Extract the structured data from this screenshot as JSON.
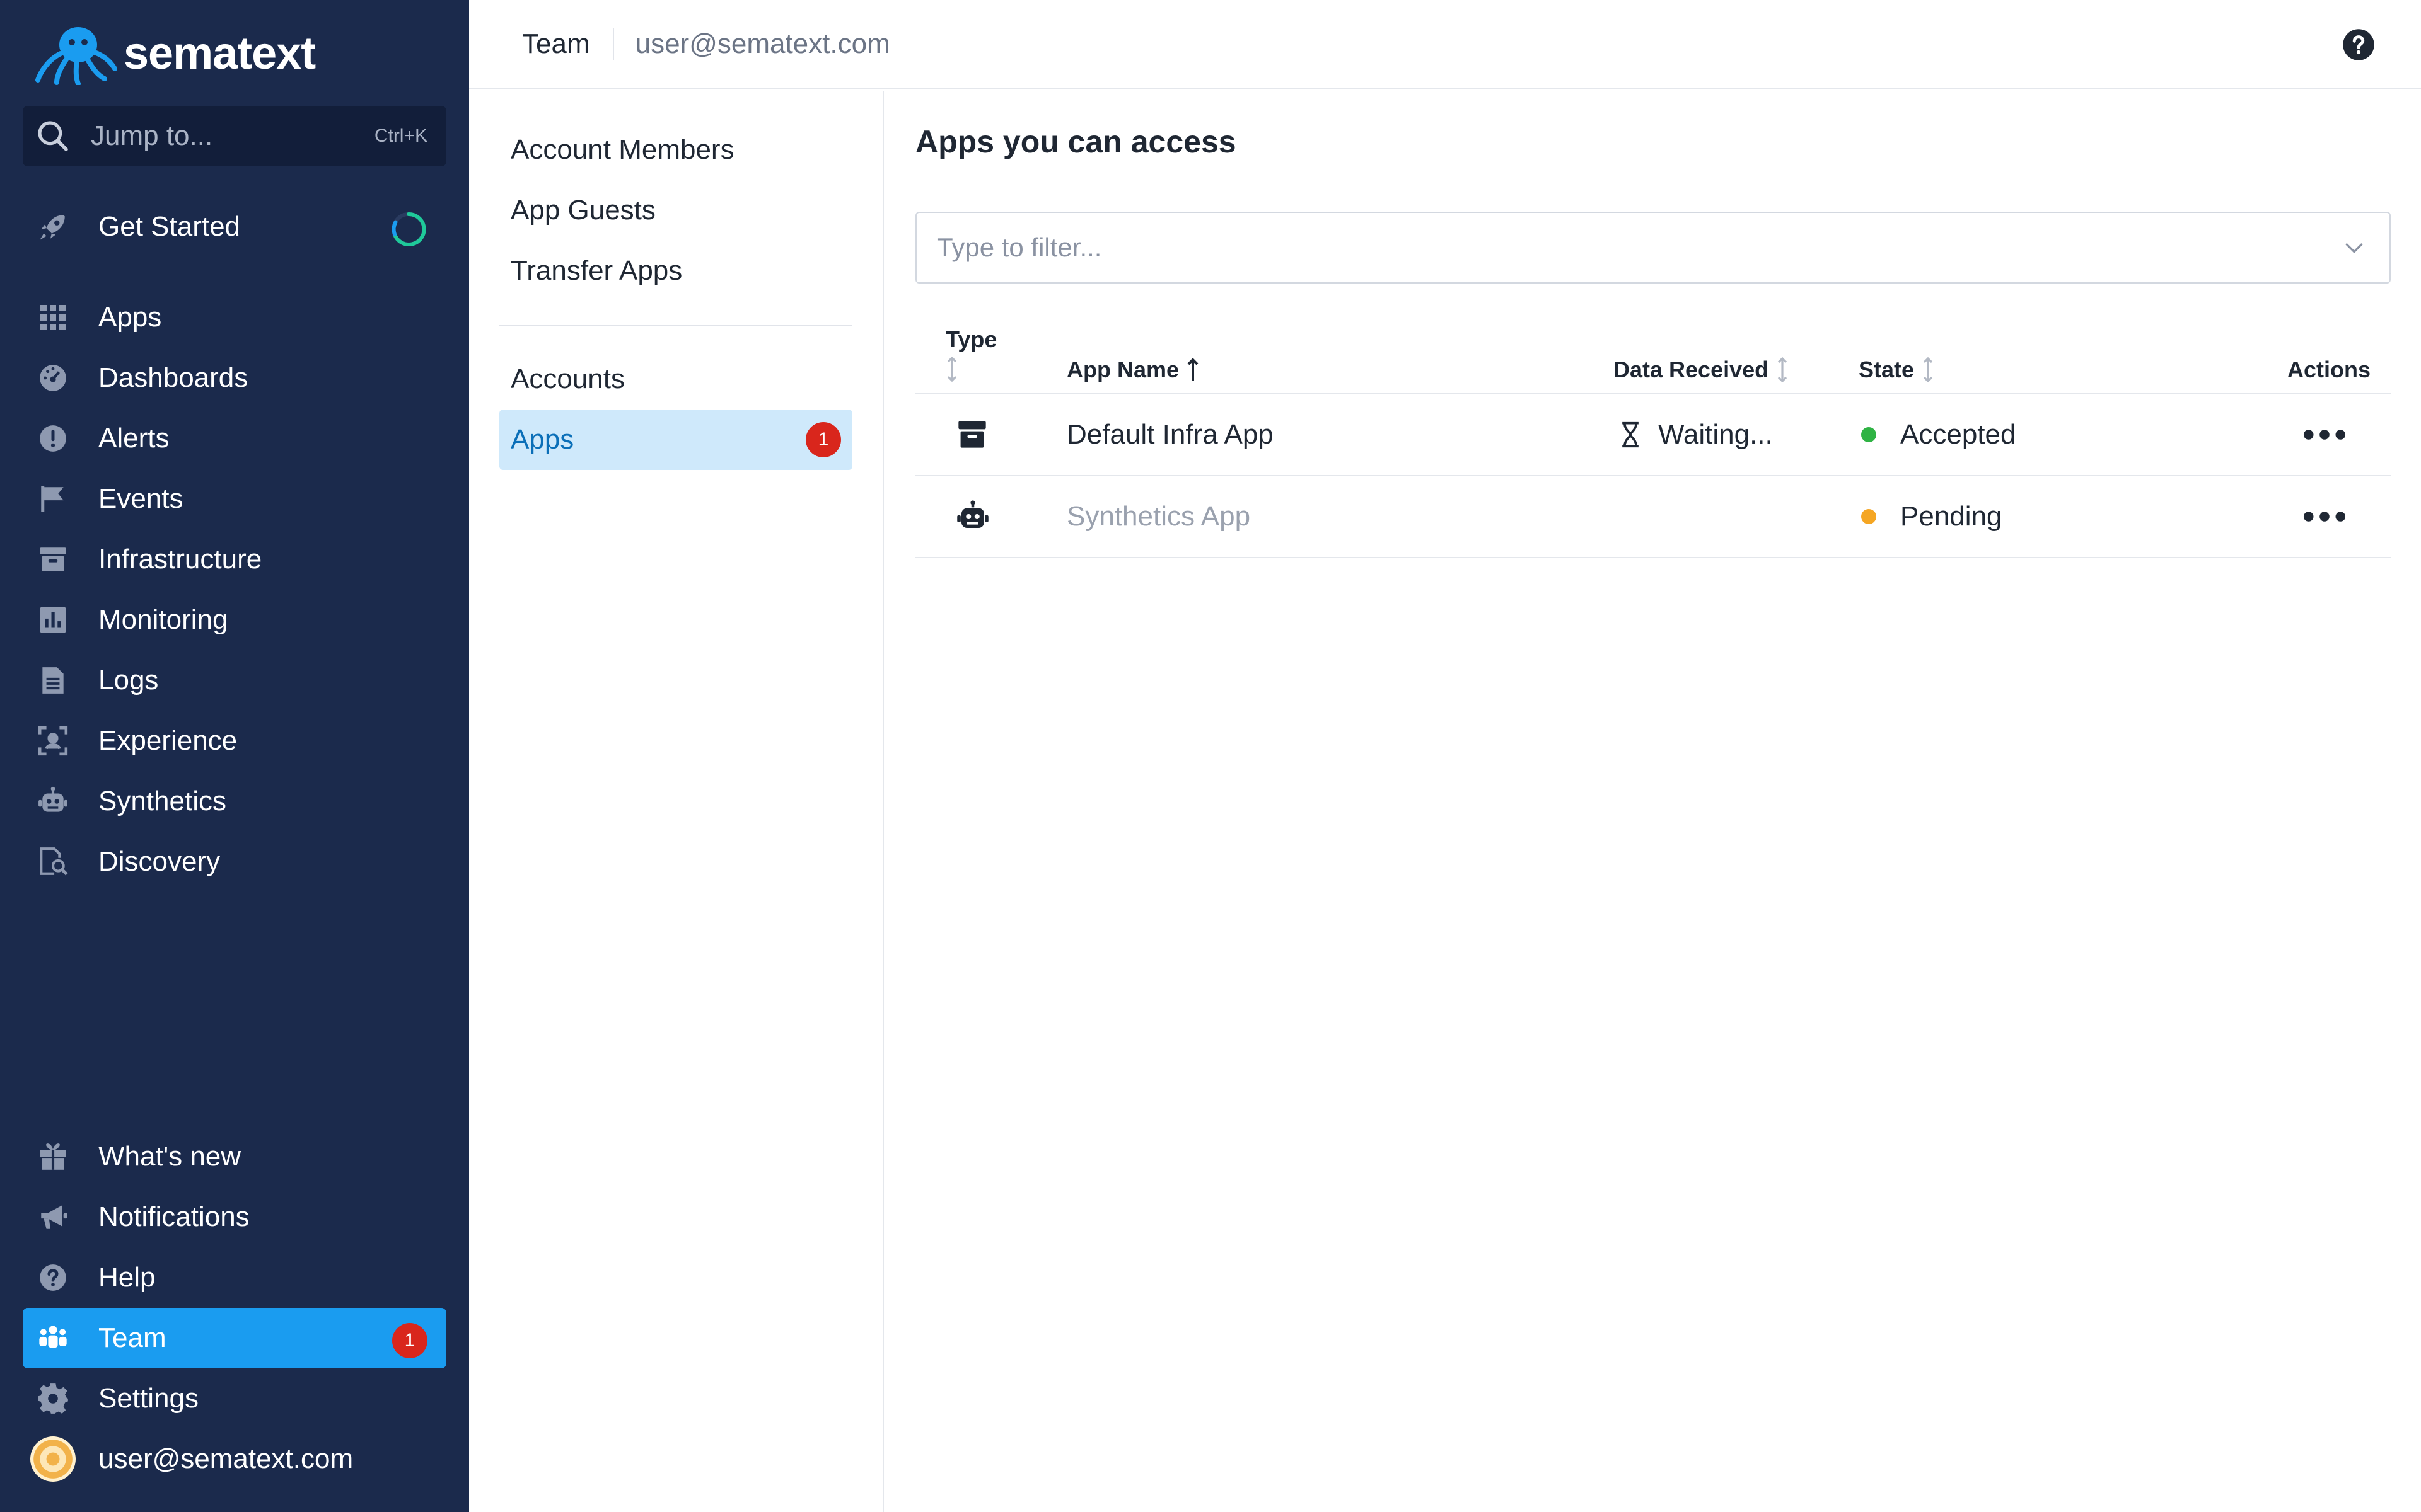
{
  "brand": {
    "name": "sematext"
  },
  "search": {
    "label": "Jump to...",
    "shortcut": "Ctrl+K"
  },
  "sidebar": {
    "get_started": "Get Started",
    "items": [
      {
        "id": "apps",
        "label": "Apps",
        "icon": "grid-icon"
      },
      {
        "id": "dashboards",
        "label": "Dashboards",
        "icon": "gauge-icon"
      },
      {
        "id": "alerts",
        "label": "Alerts",
        "icon": "alert-icon"
      },
      {
        "id": "events",
        "label": "Events",
        "icon": "flag-icon"
      },
      {
        "id": "infrastructure",
        "label": "Infrastructure",
        "icon": "archive-icon"
      },
      {
        "id": "monitoring",
        "label": "Monitoring",
        "icon": "bar-chart-icon"
      },
      {
        "id": "logs",
        "label": "Logs",
        "icon": "document-icon"
      },
      {
        "id": "experience",
        "label": "Experience",
        "icon": "user-focus-icon"
      },
      {
        "id": "synthetics",
        "label": "Synthetics",
        "icon": "robot-icon"
      },
      {
        "id": "discovery",
        "label": "Discovery",
        "icon": "doc-search-icon"
      }
    ],
    "bottom": [
      {
        "id": "whats-new",
        "label": "What's new",
        "icon": "gift-icon"
      },
      {
        "id": "notifications",
        "label": "Notifications",
        "icon": "megaphone-icon"
      },
      {
        "id": "help",
        "label": "Help",
        "icon": "help-icon"
      },
      {
        "id": "team",
        "label": "Team",
        "icon": "team-icon",
        "badge": "1",
        "active": true
      },
      {
        "id": "settings",
        "label": "Settings",
        "icon": "gear-icon"
      }
    ],
    "user": "user@sematext.com"
  },
  "topbar": {
    "title": "Team",
    "user": "user@sematext.com"
  },
  "subnav": {
    "group1": [
      "Account Members",
      "App Guests",
      "Transfer Apps"
    ],
    "group2": [
      {
        "label": "Accounts"
      },
      {
        "label": "Apps",
        "badge": "1",
        "active": true
      }
    ]
  },
  "main": {
    "title": "Apps you can access",
    "filter_placeholder": "Type to filter...",
    "columns": {
      "type": "Type",
      "name": "App Name",
      "data": "Data Received",
      "state": "State",
      "actions": "Actions"
    },
    "rows": [
      {
        "type_icon": "archive-icon",
        "name": "Default Infra App",
        "data": "Waiting...",
        "state": "Accepted",
        "state_color": "#2fb344"
      },
      {
        "type_icon": "robot-icon",
        "name": "Synthetics App",
        "data": "",
        "state": "Pending",
        "state_color": "#f5a623"
      }
    ]
  },
  "colors": {
    "sidebar_bg": "#1b2a4c",
    "active_blue": "#1a9cf0",
    "badge_red": "#d9261c"
  }
}
